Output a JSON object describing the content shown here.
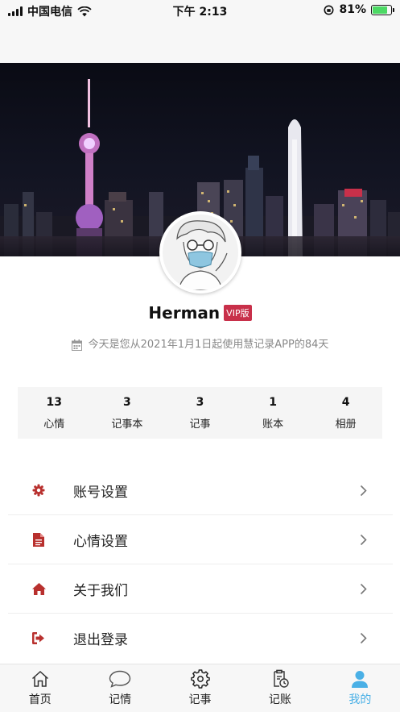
{
  "status_bar": {
    "carrier": "中国电信",
    "time": "下午 2:13",
    "battery": "81%",
    "battery_level": 0.81
  },
  "profile": {
    "username": "Herman",
    "vip_badge": "VIP版",
    "days_text": "今天是您从2021年1月1日起使用慧记录APP的84天"
  },
  "stats": [
    {
      "value": "13",
      "label": "心情"
    },
    {
      "value": "3",
      "label": "记事本"
    },
    {
      "value": "3",
      "label": "记事"
    },
    {
      "value": "1",
      "label": "账本"
    },
    {
      "value": "4",
      "label": "相册"
    }
  ],
  "menu": [
    {
      "label": "账号设置",
      "icon": "gear-icon"
    },
    {
      "label": "心情设置",
      "icon": "document-icon"
    },
    {
      "label": "关于我们",
      "icon": "home-icon"
    },
    {
      "label": "退出登录",
      "icon": "logout-icon"
    }
  ],
  "tabs": [
    {
      "label": "首页",
      "icon": "home-icon",
      "active": false
    },
    {
      "label": "记情",
      "icon": "chat-bubble-icon",
      "active": false
    },
    {
      "label": "记事",
      "icon": "gear-icon",
      "active": false
    },
    {
      "label": "记账",
      "icon": "ledger-icon",
      "active": false
    },
    {
      "label": "我的",
      "icon": "person-icon",
      "active": true
    }
  ],
  "colors": {
    "accent": "#c8304a",
    "menu_icon": "#b8302e",
    "active_tab": "#4ab0e6",
    "battery_fill": "#4cd964"
  }
}
